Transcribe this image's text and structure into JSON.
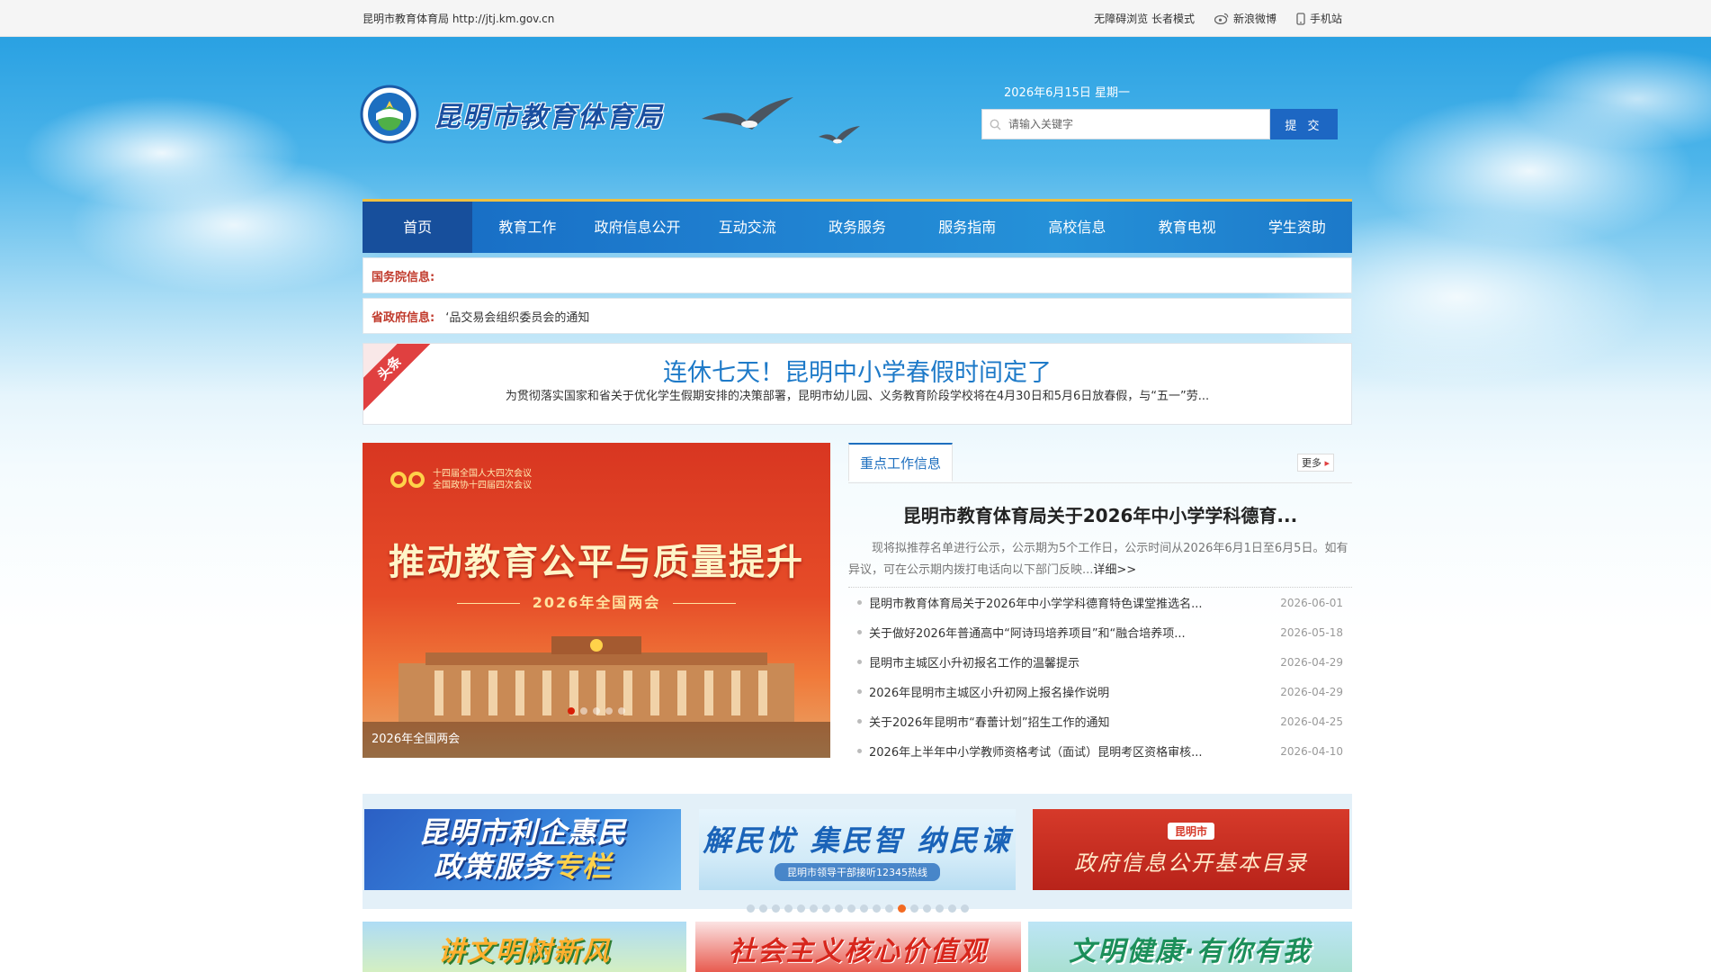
{
  "topbar": {
    "site": "昆明市教育体育局 http://jtj.km.gov.cn",
    "accessibility": "无障碍浏览 长者模式",
    "weibo": "新浪微博",
    "mobile": "手机站"
  },
  "header": {
    "logo_text": "昆明市教育体育局",
    "date": "2026年6月15日 星期一",
    "search_placeholder": "请输入关键字",
    "search_button": "提 交"
  },
  "nav": [
    "首页",
    "教育工作",
    "政府信息公开",
    "互动交流",
    "政务服务",
    "服务指南",
    "高校信息",
    "教育电视",
    "学生资助"
  ],
  "notices": {
    "state_label": "国务院信息:",
    "state_text": "",
    "province_label": "省政府信息:",
    "province_text": "‘品交易会组织委员会的通知"
  },
  "headline": {
    "ribbon": "头条",
    "title": "连休七天！昆明中小学春假时间定了",
    "summary": "为贯彻落实国家和省关于优化学生假期安排的决策部署，昆明市幼儿园、义务教育阶段学校将在4月30日和5月6日放春假，与“五一”劳..."
  },
  "slider": {
    "meeting_line1": "十四届全国人大四次会议",
    "meeting_line2": "全国政协十四届四次会议",
    "headline": "推动教育公平与质量提升",
    "subline": "2026年全国两会",
    "caption": "2026年全国两会",
    "dot_count": 5,
    "active_dot": 0
  },
  "keywork": {
    "tab": "重点工作信息",
    "more": "更多",
    "featured_title": "昆明市教育体育局关于2026年中小学学科德育...",
    "featured_summary": "现将拟推荐名单进行公示，公示期为5个工作日，公示时间从2026年6月1日至6月5日。如有异议，可在公示期内拨打电话向以下部门反映...",
    "featured_link": "详细>>",
    "items": [
      {
        "title": "昆明市教育体育局关于2026年中小学学科德育特色课堂推选名...",
        "date": "2026-06-01"
      },
      {
        "title": "关于做好2026年普通高中“阿诗玛培养项目”和“融合培养项...",
        "date": "2026-05-18"
      },
      {
        "title": "昆明市主城区小升初报名工作的温馨提示",
        "date": "2026-04-29"
      },
      {
        "title": "2026年昆明市主城区小升初网上报名操作说明",
        "date": "2026-04-29"
      },
      {
        "title": "关于2026年昆明市“春蕾计划”招生工作的通知",
        "date": "2026-04-25"
      },
      {
        "title": "2026年上半年中小学教师资格考试（面试）昆明考区资格审核...",
        "date": "2026-04-10"
      }
    ]
  },
  "banners": {
    "b1_line1": "昆明市利企惠民",
    "b1_line2a": "政策服务",
    "b1_line2b": "专栏",
    "b2_line1": "解民忧 集民智 纳民谏",
    "b2_line2": "昆明市领导干部接听12345热线",
    "b3_tag": "昆明市",
    "b3_line1": "政府信息公开基本目录",
    "dot_count": 18,
    "active_dot": 12
  },
  "bottom_banners": [
    "讲文明树新风",
    "社会主义核心价值观",
    "文明健康·有你有我"
  ]
}
